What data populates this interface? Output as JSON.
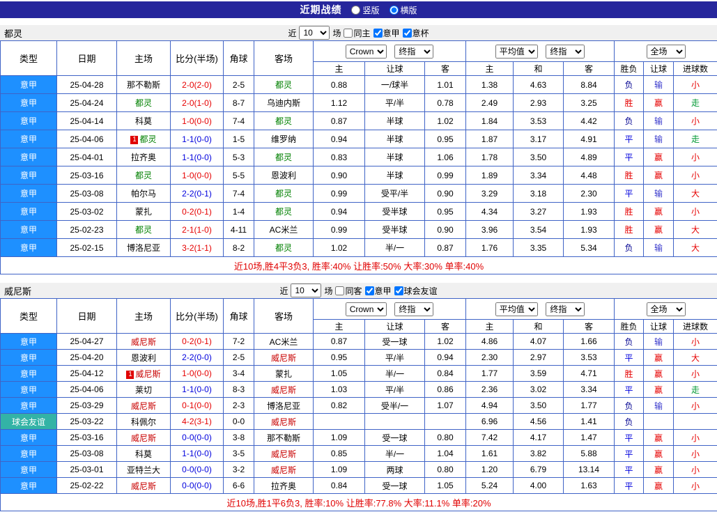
{
  "title_bar": {
    "title": "近期战绩",
    "vertical_label": "竖版",
    "horizontal_label": "横版",
    "vertical_selected": false,
    "horizontal_selected": true
  },
  "colors": {
    "bar": "#26269c",
    "grid": "#3f63c6",
    "league": "#1e90ff",
    "friendly": "#33b3a6",
    "team1": "#008000",
    "team2": "#c80000",
    "win": "#e60000",
    "draw": "#0000dd",
    "lose": "#000090",
    "hwin": "#e60000",
    "hlose": "#3838cc",
    "big": "#e60000",
    "small": "#e60000",
    "push": "#009933",
    "swin": "#e60000",
    "sdraw": "#0000dd",
    "summary": "#e00000",
    "rc": "#e00000"
  },
  "sections": [
    {
      "team": "都灵",
      "filter": {
        "near_label": "近",
        "count": "10",
        "games_label": "场",
        "checkboxes": [
          {
            "label": "同主",
            "checked": false
          },
          {
            "label": "意甲",
            "checked": true
          },
          {
            "label": "意杯",
            "checked": true
          }
        ]
      },
      "header": {
        "cols": [
          "类型",
          "日期",
          "主场",
          "比分(半场)",
          "角球",
          "客场"
        ],
        "book_select": "Crown",
        "final1": "终指",
        "avg_select": "平均值",
        "final2": "终指",
        "scope_select": "全场",
        "sub": [
          "主",
          "让球",
          "客",
          "主",
          "和",
          "客",
          "胜负",
          "让球",
          "进球数"
        ]
      },
      "rows": [
        {
          "league": "意甲",
          "league_c": "lg-league",
          "date": "25-04-28",
          "home": "那不勒斯",
          "home_c": "",
          "home_rc": "",
          "score": "2-0(2-0)",
          "score_c": "sc-dec",
          "corner": "2-5",
          "away": "都灵",
          "away_c": "focus1",
          "away_rc": "",
          "o_home": "0.88",
          "o_hcp": "一/球半",
          "o_away": "1.01",
          "e_home": "1.38",
          "e_draw": "4.63",
          "e_away": "8.84",
          "r_wdl": "负",
          "r_wdl_c": "lose",
          "r_hcp": "输",
          "r_hcp_c": "hlose",
          "r_goal": "小",
          "r_goal_c": "small"
        },
        {
          "league": "意甲",
          "league_c": "lg-league",
          "date": "25-04-24",
          "home": "都灵",
          "home_c": "focus1",
          "home_rc": "",
          "score": "2-0(1-0)",
          "score_c": "sc-dec",
          "corner": "8-7",
          "away": "乌迪内斯",
          "away_c": "",
          "away_rc": "",
          "o_home": "1.12",
          "o_hcp": "平/半",
          "o_away": "0.78",
          "e_home": "2.49",
          "e_draw": "2.93",
          "e_away": "3.25",
          "r_wdl": "胜",
          "r_wdl_c": "win",
          "r_hcp": "赢",
          "r_hcp_c": "hwin",
          "r_goal": "走",
          "r_goal_c": "push"
        },
        {
          "league": "意甲",
          "league_c": "lg-league",
          "date": "25-04-14",
          "home": "科莫",
          "home_c": "",
          "home_rc": "",
          "score": "1-0(0-0)",
          "score_c": "sc-dec",
          "corner": "7-4",
          "away": "都灵",
          "away_c": "focus1",
          "away_rc": "",
          "o_home": "0.87",
          "o_hcp": "半球",
          "o_away": "1.02",
          "e_home": "1.84",
          "e_draw": "3.53",
          "e_away": "4.42",
          "r_wdl": "负",
          "r_wdl_c": "lose",
          "r_hcp": "输",
          "r_hcp_c": "hlose",
          "r_goal": "小",
          "r_goal_c": "small"
        },
        {
          "league": "意甲",
          "league_c": "lg-league",
          "date": "25-04-06",
          "home": "都灵",
          "home_c": "focus1",
          "home_rc": "1",
          "score": "1-1(0-0)",
          "score_c": "sc-draw",
          "corner": "1-5",
          "away": "维罗纳",
          "away_c": "",
          "away_rc": "",
          "o_home": "0.94",
          "o_hcp": "半球",
          "o_away": "0.95",
          "e_home": "1.87",
          "e_draw": "3.17",
          "e_away": "4.91",
          "r_wdl": "平",
          "r_wdl_c": "draw",
          "r_hcp": "输",
          "r_hcp_c": "hlose",
          "r_goal": "走",
          "r_goal_c": "push"
        },
        {
          "league": "意甲",
          "league_c": "lg-league",
          "date": "25-04-01",
          "home": "拉齐奥",
          "home_c": "",
          "home_rc": "",
          "score": "1-1(0-0)",
          "score_c": "sc-draw",
          "corner": "5-3",
          "away": "都灵",
          "away_c": "focus1",
          "away_rc": "",
          "o_home": "0.83",
          "o_hcp": "半球",
          "o_away": "1.06",
          "e_home": "1.78",
          "e_draw": "3.50",
          "e_away": "4.89",
          "r_wdl": "平",
          "r_wdl_c": "draw",
          "r_hcp": "赢",
          "r_hcp_c": "hwin",
          "r_goal": "小",
          "r_goal_c": "small"
        },
        {
          "league": "意甲",
          "league_c": "lg-league",
          "date": "25-03-16",
          "home": "都灵",
          "home_c": "focus1",
          "home_rc": "",
          "score": "1-0(0-0)",
          "score_c": "sc-dec",
          "corner": "5-5",
          "away": "恩波利",
          "away_c": "",
          "away_rc": "",
          "o_home": "0.90",
          "o_hcp": "半球",
          "o_away": "0.99",
          "e_home": "1.89",
          "e_draw": "3.34",
          "e_away": "4.48",
          "r_wdl": "胜",
          "r_wdl_c": "win",
          "r_hcp": "赢",
          "r_hcp_c": "hwin",
          "r_goal": "小",
          "r_goal_c": "small"
        },
        {
          "league": "意甲",
          "league_c": "lg-league",
          "date": "25-03-08",
          "home": "帕尔马",
          "home_c": "",
          "home_rc": "",
          "score": "2-2(0-1)",
          "score_c": "sc-draw",
          "corner": "7-4",
          "away": "都灵",
          "away_c": "focus1",
          "away_rc": "",
          "o_home": "0.99",
          "o_hcp": "受平/半",
          "o_away": "0.90",
          "e_home": "3.29",
          "e_draw": "3.18",
          "e_away": "2.30",
          "r_wdl": "平",
          "r_wdl_c": "draw",
          "r_hcp": "输",
          "r_hcp_c": "hlose",
          "r_goal": "大",
          "r_goal_c": "big"
        },
        {
          "league": "意甲",
          "league_c": "lg-league",
          "date": "25-03-02",
          "home": "蒙扎",
          "home_c": "",
          "home_rc": "",
          "score": "0-2(0-1)",
          "score_c": "sc-dec",
          "corner": "1-4",
          "away": "都灵",
          "away_c": "focus1",
          "away_rc": "",
          "o_home": "0.94",
          "o_hcp": "受半球",
          "o_away": "0.95",
          "e_home": "4.34",
          "e_draw": "3.27",
          "e_away": "1.93",
          "r_wdl": "胜",
          "r_wdl_c": "win",
          "r_hcp": "赢",
          "r_hcp_c": "hwin",
          "r_goal": "小",
          "r_goal_c": "small"
        },
        {
          "league": "意甲",
          "league_c": "lg-league",
          "date": "25-02-23",
          "home": "都灵",
          "home_c": "focus1",
          "home_rc": "",
          "score": "2-1(1-0)",
          "score_c": "sc-dec",
          "corner": "4-11",
          "away": "AC米兰",
          "away_c": "",
          "away_rc": "",
          "o_home": "0.99",
          "o_hcp": "受半球",
          "o_away": "0.90",
          "e_home": "3.96",
          "e_draw": "3.54",
          "e_away": "1.93",
          "r_wdl": "胜",
          "r_wdl_c": "win",
          "r_hcp": "赢",
          "r_hcp_c": "hwin",
          "r_goal": "大",
          "r_goal_c": "big"
        },
        {
          "league": "意甲",
          "league_c": "lg-league",
          "date": "25-02-15",
          "home": "博洛尼亚",
          "home_c": "",
          "home_rc": "",
          "score": "3-2(1-1)",
          "score_c": "sc-dec",
          "corner": "8-2",
          "away": "都灵",
          "away_c": "focus1",
          "away_rc": "",
          "o_home": "1.02",
          "o_hcp": "半/一",
          "o_away": "0.87",
          "e_home": "1.76",
          "e_draw": "3.35",
          "e_away": "5.34",
          "r_wdl": "负",
          "r_wdl_c": "lose",
          "r_hcp": "输",
          "r_hcp_c": "hlose",
          "r_goal": "大",
          "r_goal_c": "big"
        }
      ],
      "summary": "近10场,胜4平3负3, 胜率:40% 让胜率:50% 大率:30% 单率:40%"
    },
    {
      "team": "威尼斯",
      "filter": {
        "near_label": "近",
        "count": "10",
        "games_label": "场",
        "checkboxes": [
          {
            "label": "同客",
            "checked": false
          },
          {
            "label": "意甲",
            "checked": true
          },
          {
            "label": "球会友谊",
            "checked": true
          }
        ]
      },
      "header": {
        "cols": [
          "类型",
          "日期",
          "主场",
          "比分(半场)",
          "角球",
          "客场"
        ],
        "book_select": "Crown",
        "final1": "终指",
        "avg_select": "平均值",
        "final2": "终指",
        "scope_select": "全场",
        "sub": [
          "主",
          "让球",
          "客",
          "主",
          "和",
          "客",
          "胜负",
          "让球",
          "进球数"
        ]
      },
      "rows": [
        {
          "league": "意甲",
          "league_c": "lg-league",
          "date": "25-04-27",
          "home": "威尼斯",
          "home_c": "focus2",
          "home_rc": "",
          "score": "0-2(0-1)",
          "score_c": "sc-dec",
          "corner": "7-2",
          "away": "AC米兰",
          "away_c": "",
          "away_rc": "",
          "o_home": "0.87",
          "o_hcp": "受一球",
          "o_away": "1.02",
          "e_home": "4.86",
          "e_draw": "4.07",
          "e_away": "1.66",
          "r_wdl": "负",
          "r_wdl_c": "lose",
          "r_hcp": "输",
          "r_hcp_c": "hlose",
          "r_goal": "小",
          "r_goal_c": "small"
        },
        {
          "league": "意甲",
          "league_c": "lg-league",
          "date": "25-04-20",
          "home": "恩波利",
          "home_c": "",
          "home_rc": "",
          "score": "2-2(0-0)",
          "score_c": "sc-draw",
          "corner": "2-5",
          "away": "威尼斯",
          "away_c": "focus2",
          "away_rc": "",
          "o_home": "0.95",
          "o_hcp": "平/半",
          "o_away": "0.94",
          "e_home": "2.30",
          "e_draw": "2.97",
          "e_away": "3.53",
          "r_wdl": "平",
          "r_wdl_c": "draw",
          "r_hcp": "赢",
          "r_hcp_c": "hwin",
          "r_goal": "大",
          "r_goal_c": "big"
        },
        {
          "league": "意甲",
          "league_c": "lg-league",
          "date": "25-04-12",
          "home": "威尼斯",
          "home_c": "focus2",
          "home_rc": "1",
          "score": "1-0(0-0)",
          "score_c": "sc-dec",
          "corner": "3-4",
          "away": "蒙扎",
          "away_c": "",
          "away_rc": "",
          "o_home": "1.05",
          "o_hcp": "半/一",
          "o_away": "0.84",
          "e_home": "1.77",
          "e_draw": "3.59",
          "e_away": "4.71",
          "r_wdl": "胜",
          "r_wdl_c": "win",
          "r_hcp": "赢",
          "r_hcp_c": "hwin",
          "r_goal": "小",
          "r_goal_c": "small"
        },
        {
          "league": "意甲",
          "league_c": "lg-league",
          "date": "25-04-06",
          "home": "莱切",
          "home_c": "",
          "home_rc": "",
          "score": "1-1(0-0)",
          "score_c": "sc-draw",
          "corner": "8-3",
          "away": "威尼斯",
          "away_c": "focus2",
          "away_rc": "",
          "o_home": "1.03",
          "o_hcp": "平/半",
          "o_away": "0.86",
          "e_home": "2.36",
          "e_draw": "3.02",
          "e_away": "3.34",
          "r_wdl": "平",
          "r_wdl_c": "draw",
          "r_hcp": "赢",
          "r_hcp_c": "hwin",
          "r_goal": "走",
          "r_goal_c": "push"
        },
        {
          "league": "意甲",
          "league_c": "lg-league",
          "date": "25-03-29",
          "home": "威尼斯",
          "home_c": "focus2",
          "home_rc": "",
          "score": "0-1(0-0)",
          "score_c": "sc-dec",
          "corner": "2-3",
          "away": "博洛尼亚",
          "away_c": "",
          "away_rc": "",
          "o_home": "0.82",
          "o_hcp": "受半/一",
          "o_away": "1.07",
          "e_home": "4.94",
          "e_draw": "3.50",
          "e_away": "1.77",
          "r_wdl": "负",
          "r_wdl_c": "lose",
          "r_hcp": "输",
          "r_hcp_c": "hlose",
          "r_goal": "小",
          "r_goal_c": "small"
        },
        {
          "league": "球会友谊",
          "league_c": "lg-friendly",
          "date": "25-03-22",
          "home": "科佩尔",
          "home_c": "",
          "home_rc": "",
          "score": "4-2(3-1)",
          "score_c": "sc-dec",
          "corner": "0-0",
          "away": "威尼斯",
          "away_c": "focus2",
          "away_rc": "",
          "o_home": "",
          "o_hcp": "",
          "o_away": "",
          "e_home": "6.96",
          "e_draw": "4.56",
          "e_away": "1.41",
          "r_wdl": "负",
          "r_wdl_c": "lose",
          "r_hcp": "",
          "r_hcp_c": "",
          "r_goal": "",
          "r_goal_c": ""
        },
        {
          "league": "意甲",
          "league_c": "lg-league",
          "date": "25-03-16",
          "home": "威尼斯",
          "home_c": "focus2",
          "home_rc": "",
          "score": "0-0(0-0)",
          "score_c": "sc-draw",
          "corner": "3-8",
          "away": "那不勒斯",
          "away_c": "",
          "away_rc": "",
          "o_home": "1.09",
          "o_hcp": "受一球",
          "o_away": "0.80",
          "e_home": "7.42",
          "e_draw": "4.17",
          "e_away": "1.47",
          "r_wdl": "平",
          "r_wdl_c": "draw",
          "r_hcp": "赢",
          "r_hcp_c": "hwin",
          "r_goal": "小",
          "r_goal_c": "small"
        },
        {
          "league": "意甲",
          "league_c": "lg-league",
          "date": "25-03-08",
          "home": "科莫",
          "home_c": "",
          "home_rc": "",
          "score": "1-1(0-0)",
          "score_c": "sc-draw",
          "corner": "3-5",
          "away": "威尼斯",
          "away_c": "focus2",
          "away_rc": "",
          "o_home": "0.85",
          "o_hcp": "半/一",
          "o_away": "1.04",
          "e_home": "1.61",
          "e_draw": "3.82",
          "e_away": "5.88",
          "r_wdl": "平",
          "r_wdl_c": "draw",
          "r_hcp": "赢",
          "r_hcp_c": "hwin",
          "r_goal": "小",
          "r_goal_c": "small"
        },
        {
          "league": "意甲",
          "league_c": "lg-league",
          "date": "25-03-01",
          "home": "亚特兰大",
          "home_c": "",
          "home_rc": "",
          "score": "0-0(0-0)",
          "score_c": "sc-draw",
          "corner": "3-2",
          "away": "威尼斯",
          "away_c": "focus2",
          "away_rc": "",
          "o_home": "1.09",
          "o_hcp": "两球",
          "o_away": "0.80",
          "e_home": "1.20",
          "e_draw": "6.79",
          "e_away": "13.14",
          "r_wdl": "平",
          "r_wdl_c": "draw",
          "r_hcp": "赢",
          "r_hcp_c": "hwin",
          "r_goal": "小",
          "r_goal_c": "small"
        },
        {
          "league": "意甲",
          "league_c": "lg-league",
          "date": "25-02-22",
          "home": "威尼斯",
          "home_c": "focus2",
          "home_rc": "",
          "score": "0-0(0-0)",
          "score_c": "sc-draw",
          "corner": "6-6",
          "away": "拉齐奥",
          "away_c": "",
          "away_rc": "",
          "o_home": "0.84",
          "o_hcp": "受一球",
          "o_away": "1.05",
          "e_home": "5.24",
          "e_draw": "4.00",
          "e_away": "1.63",
          "r_wdl": "平",
          "r_wdl_c": "draw",
          "r_hcp": "赢",
          "r_hcp_c": "hwin",
          "r_goal": "小",
          "r_goal_c": "small"
        }
      ],
      "summary": "近10场,胜1平6负3, 胜率:10% 让胜率:77.8% 大率:11.1% 单率:20%"
    }
  ]
}
